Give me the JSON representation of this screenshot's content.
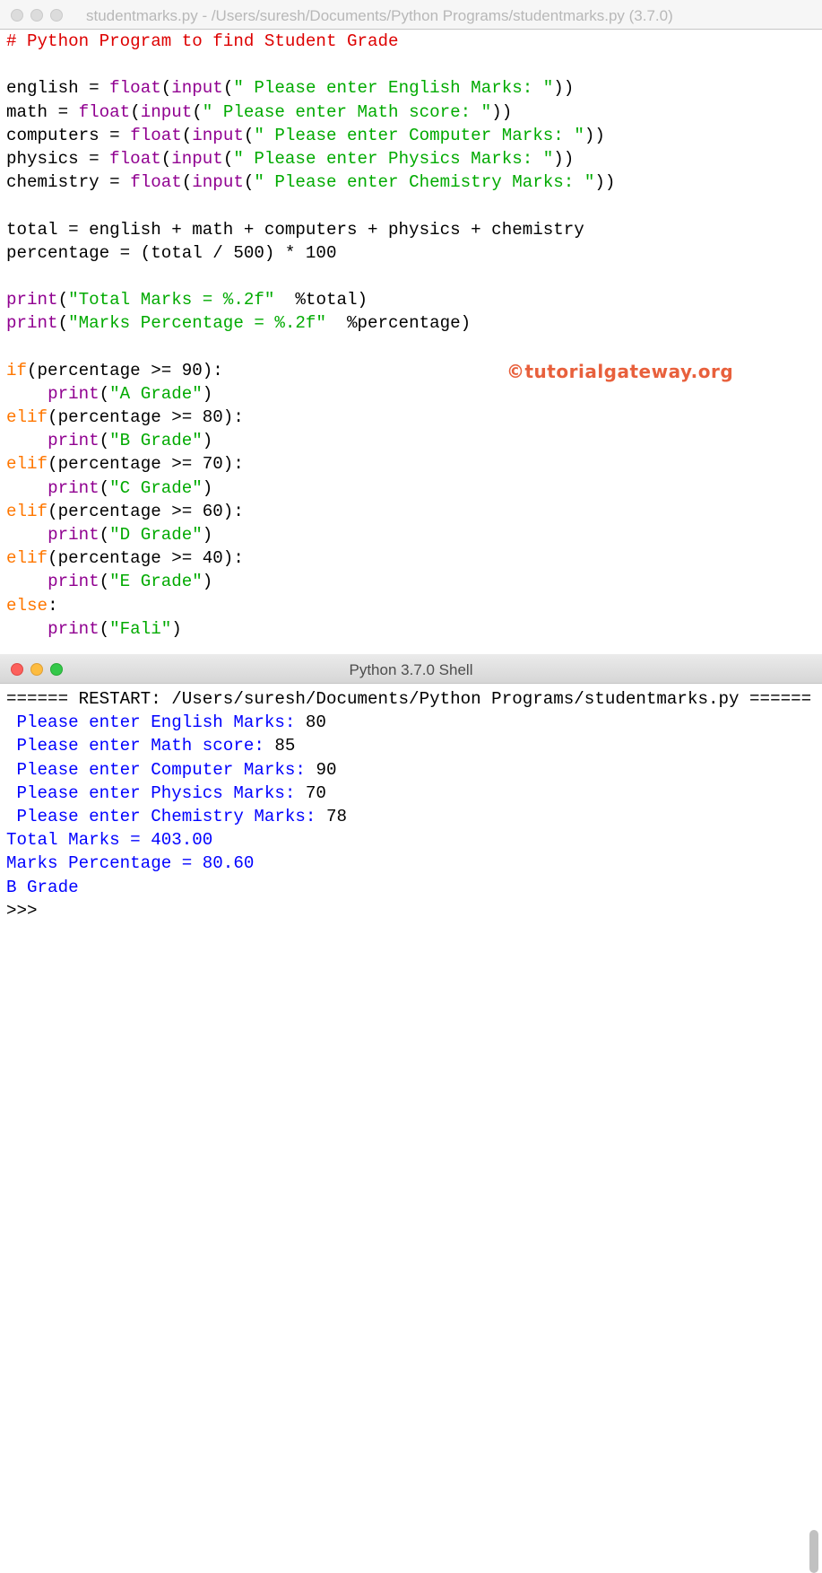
{
  "editor": {
    "title": "studentmarks.py - /Users/suresh/Documents/Python Programs/studentmarks.py (3.7.0)",
    "lines": [
      [
        {
          "t": "# Python Program to find Student Grade",
          "c": "comment"
        }
      ],
      [],
      [
        {
          "t": "english = ",
          "c": "plain"
        },
        {
          "t": "float",
          "c": "bi"
        },
        {
          "t": "(",
          "c": "plain"
        },
        {
          "t": "input",
          "c": "bi"
        },
        {
          "t": "(",
          "c": "plain"
        },
        {
          "t": "\" Please enter English Marks: \"",
          "c": "str"
        },
        {
          "t": "))",
          "c": "plain"
        }
      ],
      [
        {
          "t": "math = ",
          "c": "plain"
        },
        {
          "t": "float",
          "c": "bi"
        },
        {
          "t": "(",
          "c": "plain"
        },
        {
          "t": "input",
          "c": "bi"
        },
        {
          "t": "(",
          "c": "plain"
        },
        {
          "t": "\" Please enter Math score: \"",
          "c": "str"
        },
        {
          "t": "))",
          "c": "plain"
        }
      ],
      [
        {
          "t": "computers = ",
          "c": "plain"
        },
        {
          "t": "float",
          "c": "bi"
        },
        {
          "t": "(",
          "c": "plain"
        },
        {
          "t": "input",
          "c": "bi"
        },
        {
          "t": "(",
          "c": "plain"
        },
        {
          "t": "\" Please enter Computer Marks: \"",
          "c": "str"
        },
        {
          "t": "))",
          "c": "plain"
        }
      ],
      [
        {
          "t": "physics = ",
          "c": "plain"
        },
        {
          "t": "float",
          "c": "bi"
        },
        {
          "t": "(",
          "c": "plain"
        },
        {
          "t": "input",
          "c": "bi"
        },
        {
          "t": "(",
          "c": "plain"
        },
        {
          "t": "\" Please enter Physics Marks: \"",
          "c": "str"
        },
        {
          "t": "))",
          "c": "plain"
        }
      ],
      [
        {
          "t": "chemistry = ",
          "c": "plain"
        },
        {
          "t": "float",
          "c": "bi"
        },
        {
          "t": "(",
          "c": "plain"
        },
        {
          "t": "input",
          "c": "bi"
        },
        {
          "t": "(",
          "c": "plain"
        },
        {
          "t": "\" Please enter Chemistry Marks: \"",
          "c": "str"
        },
        {
          "t": "))",
          "c": "plain"
        }
      ],
      [],
      [
        {
          "t": "total = english + math + computers + physics + chemistry",
          "c": "plain"
        }
      ],
      [
        {
          "t": "percentage = (total / 500) * 100",
          "c": "plain"
        }
      ],
      [],
      [
        {
          "t": "print",
          "c": "bi"
        },
        {
          "t": "(",
          "c": "plain"
        },
        {
          "t": "\"Total Marks = %.2f\"",
          "c": "str"
        },
        {
          "t": "  %total)",
          "c": "plain"
        }
      ],
      [
        {
          "t": "print",
          "c": "bi"
        },
        {
          "t": "(",
          "c": "plain"
        },
        {
          "t": "\"Marks Percentage = %.2f\"",
          "c": "str"
        },
        {
          "t": "  %percentage)",
          "c": "plain"
        }
      ],
      [],
      [
        {
          "t": "if",
          "c": "kw"
        },
        {
          "t": "(percentage >= 90):",
          "c": "plain"
        }
      ],
      [
        {
          "t": "    ",
          "c": "plain"
        },
        {
          "t": "print",
          "c": "bi"
        },
        {
          "t": "(",
          "c": "plain"
        },
        {
          "t": "\"A Grade\"",
          "c": "str"
        },
        {
          "t": ")",
          "c": "plain"
        }
      ],
      [
        {
          "t": "elif",
          "c": "kw"
        },
        {
          "t": "(percentage >= 80):",
          "c": "plain"
        }
      ],
      [
        {
          "t": "    ",
          "c": "plain"
        },
        {
          "t": "print",
          "c": "bi"
        },
        {
          "t": "(",
          "c": "plain"
        },
        {
          "t": "\"B Grade\"",
          "c": "str"
        },
        {
          "t": ")",
          "c": "plain"
        }
      ],
      [
        {
          "t": "elif",
          "c": "kw"
        },
        {
          "t": "(percentage >= 70):",
          "c": "plain"
        }
      ],
      [
        {
          "t": "    ",
          "c": "plain"
        },
        {
          "t": "print",
          "c": "bi"
        },
        {
          "t": "(",
          "c": "plain"
        },
        {
          "t": "\"C Grade\"",
          "c": "str"
        },
        {
          "t": ")",
          "c": "plain"
        }
      ],
      [
        {
          "t": "elif",
          "c": "kw"
        },
        {
          "t": "(percentage >= 60):",
          "c": "plain"
        }
      ],
      [
        {
          "t": "    ",
          "c": "plain"
        },
        {
          "t": "print",
          "c": "bi"
        },
        {
          "t": "(",
          "c": "plain"
        },
        {
          "t": "\"D Grade\"",
          "c": "str"
        },
        {
          "t": ")",
          "c": "plain"
        }
      ],
      [
        {
          "t": "elif",
          "c": "kw"
        },
        {
          "t": "(percentage >= 40):",
          "c": "plain"
        }
      ],
      [
        {
          "t": "    ",
          "c": "plain"
        },
        {
          "t": "print",
          "c": "bi"
        },
        {
          "t": "(",
          "c": "plain"
        },
        {
          "t": "\"E Grade\"",
          "c": "str"
        },
        {
          "t": ")",
          "c": "plain"
        }
      ],
      [
        {
          "t": "else",
          "c": "kw"
        },
        {
          "t": ":",
          "c": "plain"
        }
      ],
      [
        {
          "t": "    ",
          "c": "plain"
        },
        {
          "t": "print",
          "c": "bi"
        },
        {
          "t": "(",
          "c": "plain"
        },
        {
          "t": "\"Fali\"",
          "c": "str"
        },
        {
          "t": ")",
          "c": "plain"
        }
      ]
    ]
  },
  "watermark": "©tutorialgateway.org",
  "shell": {
    "title": "Python 3.7.0 Shell",
    "lines": [
      [
        {
          "t": "====== RESTART: /Users/suresh/Documents/Python Programs/studentmarks.py ======",
          "c": "plain"
        }
      ],
      [
        {
          "t": " Please enter English Marks: ",
          "c": "stdout"
        },
        {
          "t": "80",
          "c": "plain"
        }
      ],
      [
        {
          "t": " Please enter Math score: ",
          "c": "stdout"
        },
        {
          "t": "85",
          "c": "plain"
        }
      ],
      [
        {
          "t": " Please enter Computer Marks: ",
          "c": "stdout"
        },
        {
          "t": "90",
          "c": "plain"
        }
      ],
      [
        {
          "t": " Please enter Physics Marks: ",
          "c": "stdout"
        },
        {
          "t": "70",
          "c": "plain"
        }
      ],
      [
        {
          "t": " Please enter Chemistry Marks: ",
          "c": "stdout"
        },
        {
          "t": "78",
          "c": "plain"
        }
      ],
      [
        {
          "t": "Total Marks = 403.00",
          "c": "stdout"
        }
      ],
      [
        {
          "t": "Marks Percentage = 80.60",
          "c": "stdout"
        }
      ],
      [
        {
          "t": "B Grade",
          "c": "stdout"
        }
      ],
      [
        {
          "t": ">>> ",
          "c": "plain"
        }
      ]
    ]
  },
  "colors": {
    "keyword": "#ff7700",
    "comment": "#dd0000",
    "string": "#00aa00",
    "builtin": "#900090",
    "stdout": "#0000ff",
    "watermark": "#e8603c",
    "close": "#fc605c",
    "minimize": "#fdbc40",
    "zoom": "#34c84a"
  }
}
